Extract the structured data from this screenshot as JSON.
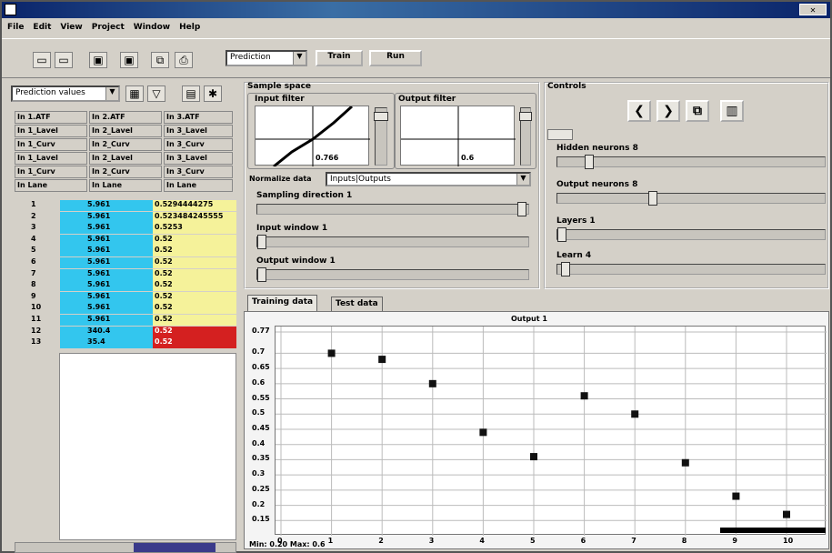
{
  "app": {
    "menu": [
      "File",
      "Edit",
      "View",
      "Project",
      "Window",
      "Help"
    ]
  },
  "toolbar": {
    "buttons": [
      "new-icon",
      "open-icon",
      "save-icon",
      "save-as-icon",
      "copy-icon",
      "print-icon"
    ],
    "dropdown_value": "Prediction",
    "train_label": "Train",
    "run_label": "Run"
  },
  "left": {
    "combo_value": "Prediction values",
    "header_cells": [
      [
        "In 1.ATF",
        "In 2.ATF",
        "In 3.ATF"
      ],
      [
        "In 1_Lavel",
        "In 2_Lavel",
        "In 3_Lavel"
      ],
      [
        "In 1_Curv",
        "In 2_Curv",
        "In 3_Curv"
      ],
      [
        "In 1_Lavel",
        "In 2_Lavel",
        "In 3_Lavel"
      ],
      [
        "In 1_Curv",
        "In 2_Curv",
        "In 3_Curv"
      ],
      [
        "In Lane",
        "In Lane",
        "In Lane"
      ]
    ],
    "rows": [
      {
        "idx": "1",
        "v": "5.961",
        "out": "0.5294444275"
      },
      {
        "idx": "2",
        "v": "5.961",
        "out": "0.523484245555"
      },
      {
        "idx": "3",
        "v": "5.961",
        "out": "0.5253"
      },
      {
        "idx": "4",
        "v": "5.961",
        "out": "0.52"
      },
      {
        "idx": "5",
        "v": "5.961",
        "out": "0.52"
      },
      {
        "idx": "6",
        "v": "5.961",
        "out": "0.52"
      },
      {
        "idx": "7",
        "v": "5.961",
        "out": "0.52"
      },
      {
        "idx": "8",
        "v": "5.961",
        "out": "0.52"
      },
      {
        "idx": "9",
        "v": "5.961",
        "out": "0.52"
      },
      {
        "idx": "10",
        "v": "5.961",
        "out": "0.52"
      },
      {
        "idx": "11",
        "v": "5.961",
        "out": "0.52"
      },
      {
        "idx": "12",
        "v": "340.4",
        "out": "0.52"
      },
      {
        "idx": "13",
        "v": "35.4",
        "out": "0.52"
      }
    ]
  },
  "mid": {
    "title": "Sample space",
    "input_filter": "Input filter",
    "output_filter": "Output filter",
    "input_val": "0.766",
    "output_val": "0.6",
    "normalize_label": "Normalize data",
    "normalize_value": "Inputs|Outputs",
    "slider1": "Sampling direction 1",
    "slider2": "Input window 1",
    "slider3": "Output window 1"
  },
  "right": {
    "title": "Controls",
    "slider1": "Hidden neurons 8",
    "slider2": "Output neurons 8",
    "slider3": "Layers 1",
    "slider4": "Learn 4"
  },
  "bottom": {
    "tab_training": "Training data",
    "tab_test": "Test data",
    "status": "Min: 0.20 Max: 0.6"
  },
  "chart_data": {
    "type": "scatter",
    "title": "Output 1",
    "xlabel": "",
    "ylabel": "",
    "x": [
      1,
      2,
      3,
      4,
      5,
      6,
      7,
      8,
      9,
      10
    ],
    "y": [
      0.7,
      0.68,
      0.6,
      0.44,
      0.36,
      0.56,
      0.5,
      0.34,
      0.23,
      0.17
    ],
    "ylim": [
      0.1,
      0.77
    ],
    "yticks": [
      "0.77",
      "0.7",
      "0.65",
      "0.6",
      "0.55",
      "0.5",
      "0.45",
      "0.4",
      "0.35",
      "0.3",
      "0.25",
      "0.2",
      "0.15"
    ],
    "xticks": [
      "0",
      "1",
      "2",
      "3",
      "4",
      "5",
      "6",
      "7",
      "8",
      "9",
      "10"
    ],
    "grid": true
  }
}
